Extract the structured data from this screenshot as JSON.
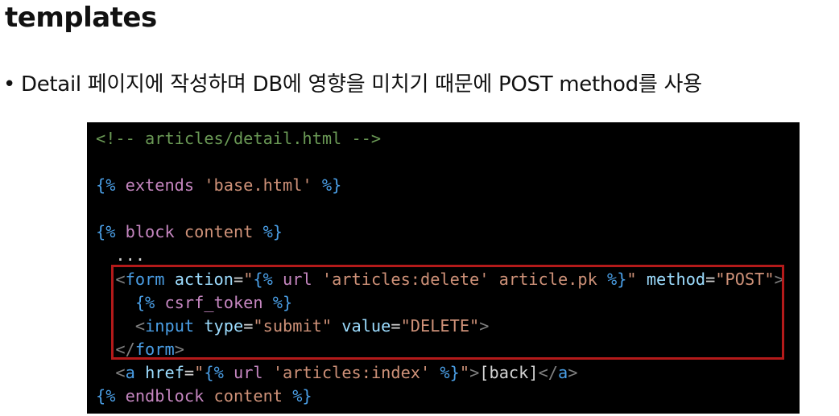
{
  "slide": {
    "title": "templates",
    "bullet": "Detail 페이지에 작성하며 DB에 영향을 미치기 때문에 POST method를 사용"
  },
  "code": {
    "lines": [
      [
        {
          "t": "<!-- articles/detail.html -->",
          "c": "com"
        }
      ],
      [],
      [
        {
          "t": "{%",
          "c": "brace"
        },
        {
          "t": " extends ",
          "c": "kw"
        },
        {
          "t": "'base.html'",
          "c": "str"
        },
        {
          "t": " %}",
          "c": "brace"
        }
      ],
      [],
      [
        {
          "t": "{%",
          "c": "brace"
        },
        {
          "t": " block ",
          "c": "kw"
        },
        {
          "t": "content",
          "c": "name"
        },
        {
          "t": " %}",
          "c": "brace"
        }
      ],
      [
        {
          "t": "  ...",
          "c": "txt"
        }
      ],
      [
        {
          "t": "  <",
          "c": "punc"
        },
        {
          "t": "form",
          "c": "tag"
        },
        {
          "t": " action",
          "c": "attr"
        },
        {
          "t": "=",
          "c": "txt"
        },
        {
          "t": "\"",
          "c": "str"
        },
        {
          "t": "{%",
          "c": "brace"
        },
        {
          "t": " url ",
          "c": "kw"
        },
        {
          "t": "'articles:delete'",
          "c": "str"
        },
        {
          "t": " article.pk ",
          "c": "name"
        },
        {
          "t": "%}",
          "c": "brace"
        },
        {
          "t": "\"",
          "c": "str"
        },
        {
          "t": " method",
          "c": "attr"
        },
        {
          "t": "=",
          "c": "txt"
        },
        {
          "t": "\"POST\"",
          "c": "str"
        },
        {
          "t": ">",
          "c": "punc"
        }
      ],
      [
        {
          "t": "    ",
          "c": "txt"
        },
        {
          "t": "{%",
          "c": "brace"
        },
        {
          "t": " csrf_token ",
          "c": "kw"
        },
        {
          "t": "%}",
          "c": "brace"
        }
      ],
      [
        {
          "t": "    <",
          "c": "punc"
        },
        {
          "t": "input",
          "c": "tag"
        },
        {
          "t": " type",
          "c": "attr"
        },
        {
          "t": "=",
          "c": "txt"
        },
        {
          "t": "\"submit\"",
          "c": "str"
        },
        {
          "t": " value",
          "c": "attr"
        },
        {
          "t": "=",
          "c": "txt"
        },
        {
          "t": "\"DELETE\"",
          "c": "str"
        },
        {
          "t": ">",
          "c": "punc"
        }
      ],
      [
        {
          "t": "  </",
          "c": "punc"
        },
        {
          "t": "form",
          "c": "tag"
        },
        {
          "t": ">",
          "c": "punc"
        }
      ],
      [
        {
          "t": "  <",
          "c": "punc"
        },
        {
          "t": "a",
          "c": "tag"
        },
        {
          "t": " href",
          "c": "attr"
        },
        {
          "t": "=",
          "c": "txt"
        },
        {
          "t": "\"",
          "c": "str"
        },
        {
          "t": "{%",
          "c": "brace"
        },
        {
          "t": " url ",
          "c": "kw"
        },
        {
          "t": "'articles:index'",
          "c": "str"
        },
        {
          "t": " %}",
          "c": "brace"
        },
        {
          "t": "\"",
          "c": "str"
        },
        {
          "t": ">",
          "c": "punc"
        },
        {
          "t": "[back]",
          "c": "txt"
        },
        {
          "t": "</",
          "c": "punc"
        },
        {
          "t": "a",
          "c": "tag"
        },
        {
          "t": ">",
          "c": "punc"
        }
      ],
      [
        {
          "t": "{%",
          "c": "brace"
        },
        {
          "t": " endblock ",
          "c": "kw"
        },
        {
          "t": "content",
          "c": "name"
        },
        {
          "t": " %}",
          "c": "brace"
        }
      ]
    ]
  },
  "colors": {
    "code_background": "#000000",
    "highlight_border": "#b41a1a"
  }
}
